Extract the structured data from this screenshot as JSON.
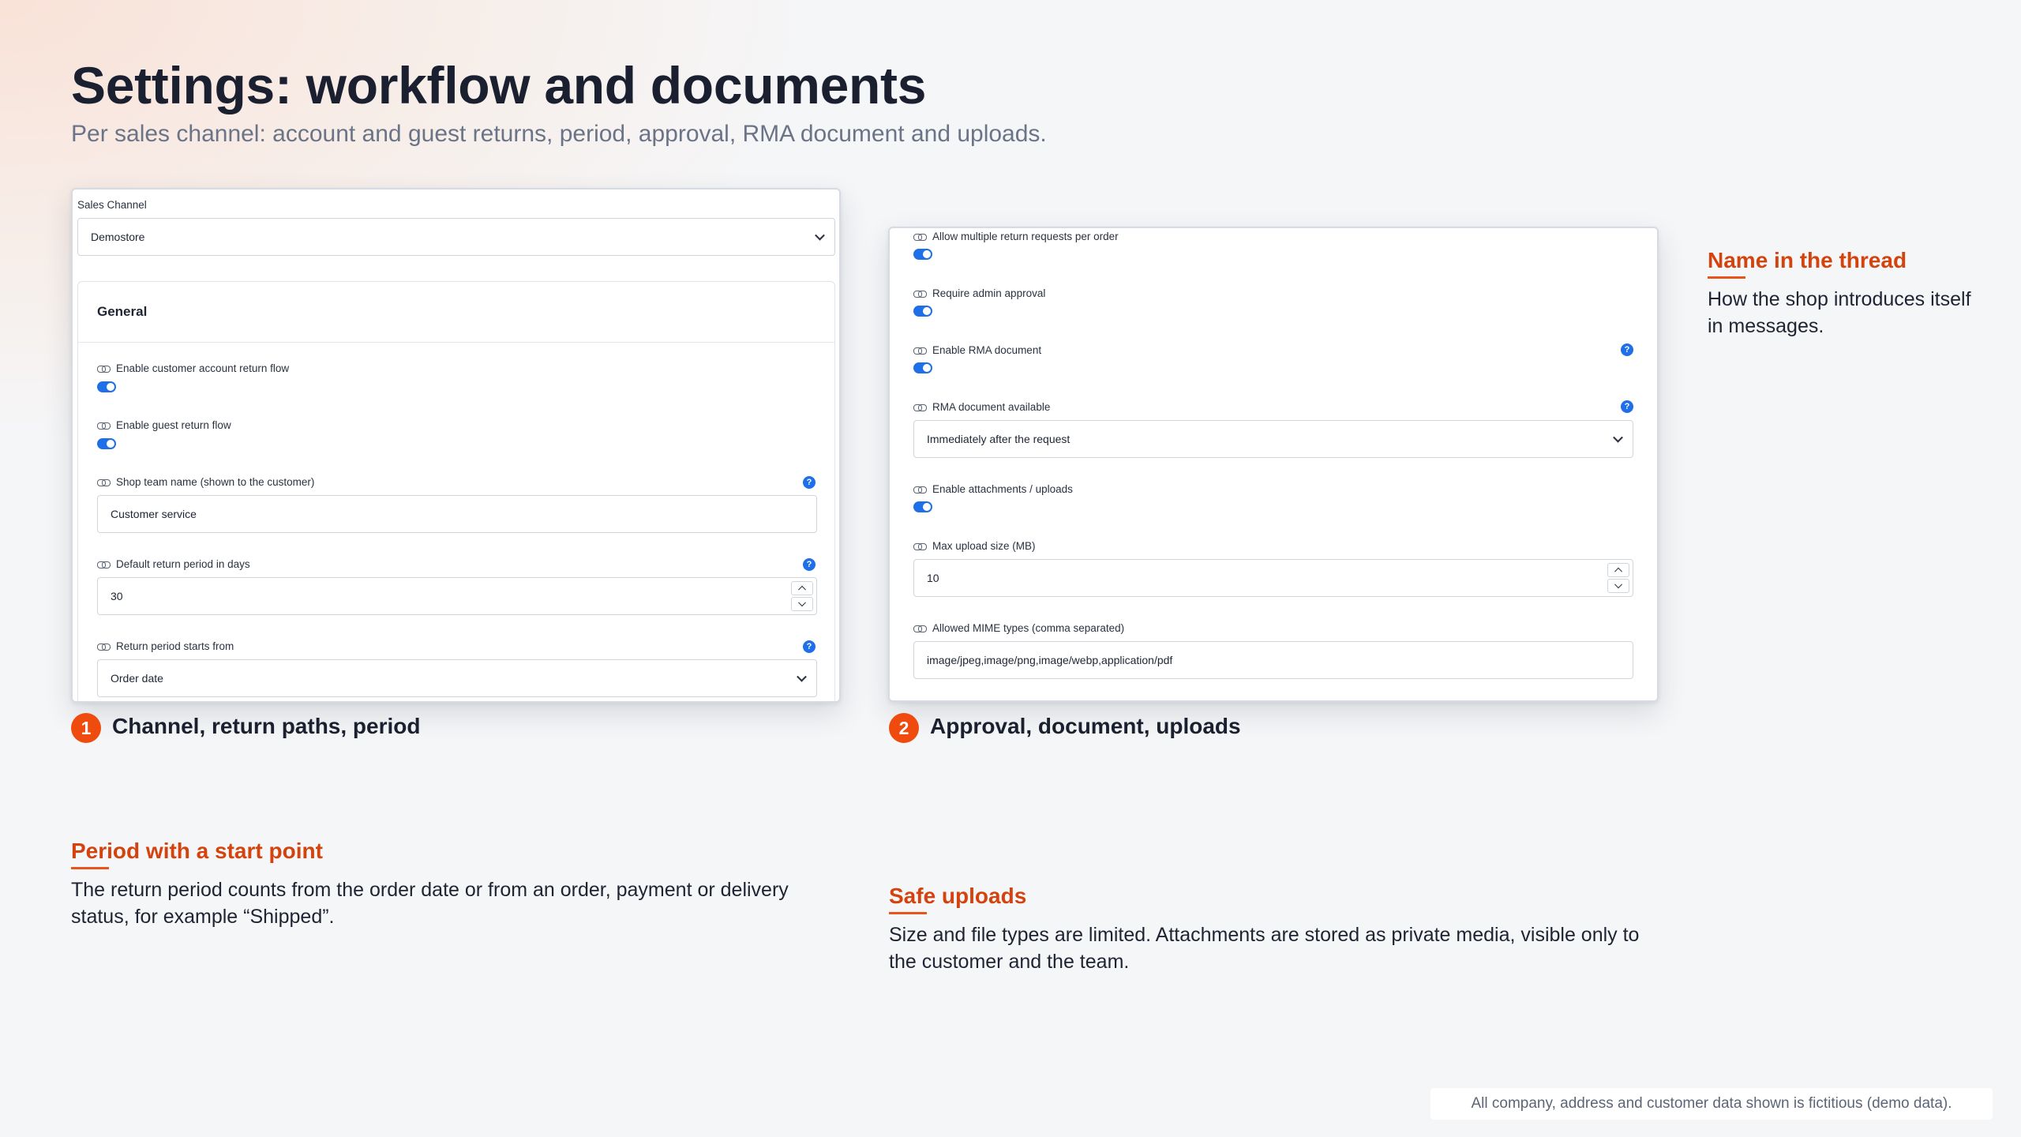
{
  "header": {
    "title": "Settings: workflow and documents",
    "subtitle": "Per sales channel: account and guest returns, period, approval, RMA document and uploads."
  },
  "shot1": {
    "sales_channel_label": "Sales Channel",
    "sales_channel_value": "Demostore",
    "card_title": "General",
    "fields": [
      {
        "label": "Enable customer account return flow"
      },
      {
        "label": "Enable guest return flow"
      },
      {
        "label": "Shop team name (shown to the customer)",
        "value": "Customer service"
      },
      {
        "label": "Default return period in days",
        "value": "30"
      },
      {
        "label": "Return period starts from",
        "value": "Order date"
      }
    ]
  },
  "shot2": {
    "fields": [
      {
        "label": "Allow multiple return requests per order"
      },
      {
        "label": "Require admin approval"
      },
      {
        "label": "Enable RMA document"
      },
      {
        "label": "RMA document available",
        "value": "Immediately after the request"
      },
      {
        "label": "Enable attachments / uploads"
      },
      {
        "label": "Max upload size (MB)",
        "value": "10"
      },
      {
        "label": "Allowed MIME types (comma separated)",
        "value": "image/jpeg,image/png,image/webp,application/pdf"
      }
    ]
  },
  "steps": [
    {
      "number": "1",
      "title": "Channel, return paths, period"
    },
    {
      "number": "2",
      "title": "Approval, document, uploads"
    }
  ],
  "notes": {
    "thread": {
      "title": "Name in the thread",
      "body": "How the shop introduces itself in messages."
    },
    "period": {
      "title": "Period with a start point",
      "body": "The return period counts from the order date or from an order, payment or delivery status, for example “Shipped”."
    },
    "uploads": {
      "title": "Safe uploads",
      "body": "Size and file types are limited. Attachments are stored as private media, visible only to the customer and the team."
    }
  },
  "footer": "All company, address and customer data shown is fictitious (demo data).",
  "colors": {
    "accent": "#f04b0f",
    "note_title": "#d4430e",
    "toggle_on": "#1e6fe8"
  },
  "toggles": {
    "enabled": true
  },
  "icons": {
    "field_prefix": "link-icon",
    "help": "help-icon",
    "select": "chevron-down-icon"
  },
  "help_glyph": "?"
}
